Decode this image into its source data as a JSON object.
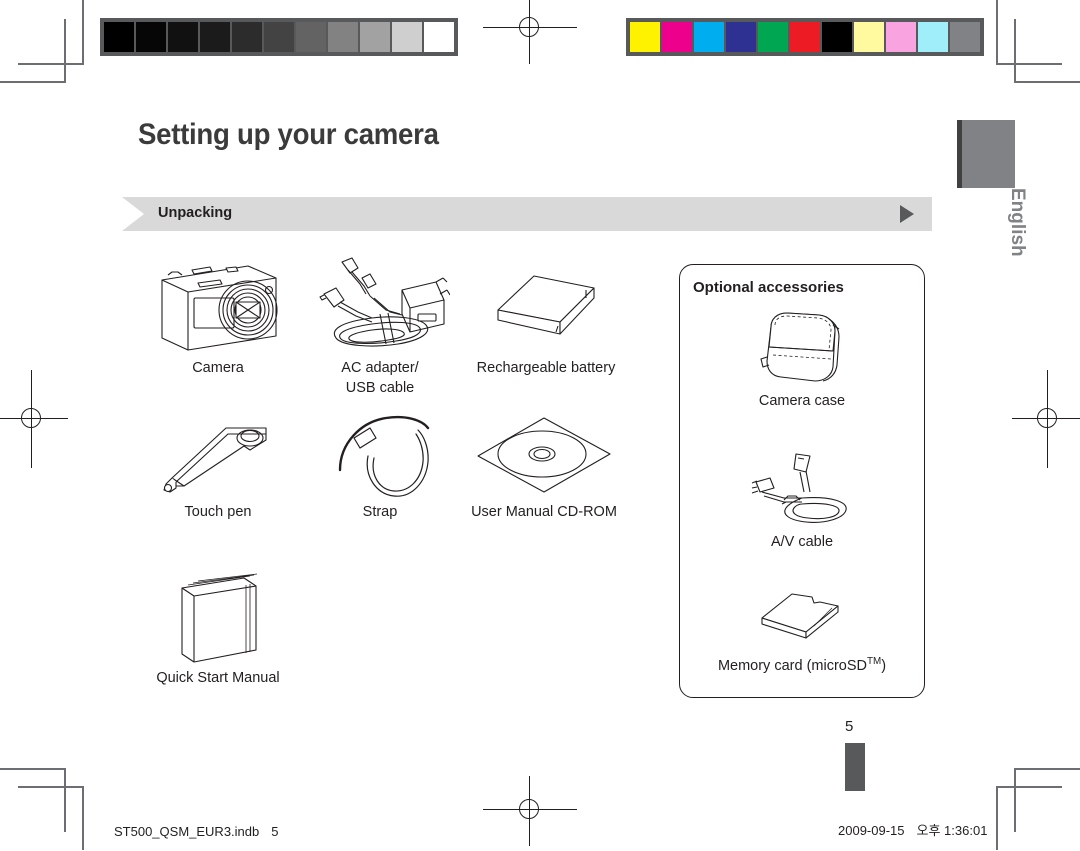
{
  "document": {
    "title": "Setting up your camera",
    "section_heading": "Unpacking",
    "language_tab": "English",
    "page_number": "5"
  },
  "calibration": {
    "grayscale_label": "grayscale-step-wedge",
    "grayscale_swatches": [
      "#000000",
      "#060606",
      "#111111",
      "#1b1b1b",
      "#2c2c2c",
      "#434343",
      "#636363",
      "#828282",
      "#a2a2a2",
      "#cfcfcf",
      "#ffffff"
    ],
    "color_label": "color-control-bar",
    "color_swatches": [
      "#fff200",
      "#ec008c",
      "#00aeef",
      "#2e3192",
      "#00a651",
      "#ed1c24",
      "#000000",
      "#fff9a0",
      "#f9a3e0",
      "#a0eef9",
      "#808285"
    ]
  },
  "items": [
    {
      "name": "camera",
      "caption": "Camera"
    },
    {
      "name": "ac-adapter-usb-cable",
      "caption": "AC adapter/\nUSB cable"
    },
    {
      "name": "rechargeable-battery",
      "caption": "Rechargeable battery"
    },
    {
      "name": "touch-pen",
      "caption": "Touch pen"
    },
    {
      "name": "strap",
      "caption": "Strap"
    },
    {
      "name": "user-manual-cd-rom",
      "caption": "User Manual CD-ROM"
    },
    {
      "name": "quick-start-manual",
      "caption": "Quick Start Manual"
    }
  ],
  "optional": {
    "title": "Optional accessories",
    "items": [
      {
        "name": "camera-case",
        "caption": "Camera case"
      },
      {
        "name": "av-cable",
        "caption": "A/V cable"
      },
      {
        "name": "memory-card",
        "caption_prefix": "Memory card (microSD",
        "caption_tm": "TM",
        "caption_suffix": ")"
      }
    ]
  },
  "footer": {
    "file_name": "ST500_QSM_EUR3.indb",
    "file_page": "5",
    "date": "2009-09-15",
    "meridiem": "오후",
    "time": "1:36:01"
  }
}
